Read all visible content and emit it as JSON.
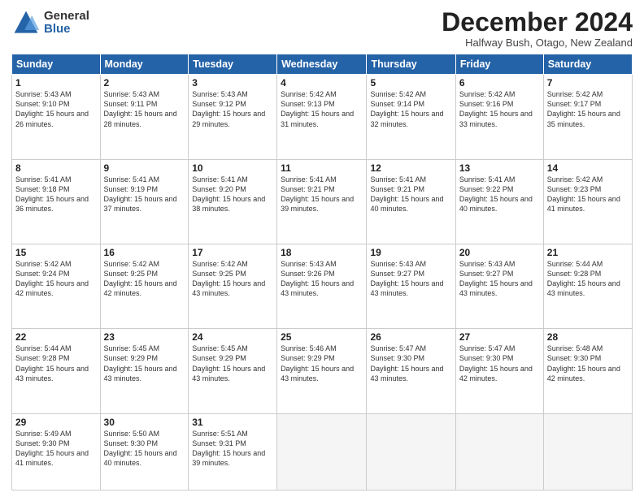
{
  "logo": {
    "general": "General",
    "blue": "Blue"
  },
  "title": "December 2024",
  "location": "Halfway Bush, Otago, New Zealand",
  "weekdays": [
    "Sunday",
    "Monday",
    "Tuesday",
    "Wednesday",
    "Thursday",
    "Friday",
    "Saturday"
  ],
  "weeks": [
    [
      {
        "day": "1",
        "sunrise": "5:43 AM",
        "sunset": "9:10 PM",
        "daylight": "15 hours and 26 minutes."
      },
      {
        "day": "2",
        "sunrise": "5:43 AM",
        "sunset": "9:11 PM",
        "daylight": "15 hours and 28 minutes."
      },
      {
        "day": "3",
        "sunrise": "5:43 AM",
        "sunset": "9:12 PM",
        "daylight": "15 hours and 29 minutes."
      },
      {
        "day": "4",
        "sunrise": "5:42 AM",
        "sunset": "9:13 PM",
        "daylight": "15 hours and 31 minutes."
      },
      {
        "day": "5",
        "sunrise": "5:42 AM",
        "sunset": "9:14 PM",
        "daylight": "15 hours and 32 minutes."
      },
      {
        "day": "6",
        "sunrise": "5:42 AM",
        "sunset": "9:16 PM",
        "daylight": "15 hours and 33 minutes."
      },
      {
        "day": "7",
        "sunrise": "5:42 AM",
        "sunset": "9:17 PM",
        "daylight": "15 hours and 35 minutes."
      }
    ],
    [
      {
        "day": "8",
        "sunrise": "5:41 AM",
        "sunset": "9:18 PM",
        "daylight": "15 hours and 36 minutes."
      },
      {
        "day": "9",
        "sunrise": "5:41 AM",
        "sunset": "9:19 PM",
        "daylight": "15 hours and 37 minutes."
      },
      {
        "day": "10",
        "sunrise": "5:41 AM",
        "sunset": "9:20 PM",
        "daylight": "15 hours and 38 minutes."
      },
      {
        "day": "11",
        "sunrise": "5:41 AM",
        "sunset": "9:21 PM",
        "daylight": "15 hours and 39 minutes."
      },
      {
        "day": "12",
        "sunrise": "5:41 AM",
        "sunset": "9:21 PM",
        "daylight": "15 hours and 40 minutes."
      },
      {
        "day": "13",
        "sunrise": "5:41 AM",
        "sunset": "9:22 PM",
        "daylight": "15 hours and 40 minutes."
      },
      {
        "day": "14",
        "sunrise": "5:42 AM",
        "sunset": "9:23 PM",
        "daylight": "15 hours and 41 minutes."
      }
    ],
    [
      {
        "day": "15",
        "sunrise": "5:42 AM",
        "sunset": "9:24 PM",
        "daylight": "15 hours and 42 minutes."
      },
      {
        "day": "16",
        "sunrise": "5:42 AM",
        "sunset": "9:25 PM",
        "daylight": "15 hours and 42 minutes."
      },
      {
        "day": "17",
        "sunrise": "5:42 AM",
        "sunset": "9:25 PM",
        "daylight": "15 hours and 43 minutes."
      },
      {
        "day": "18",
        "sunrise": "5:43 AM",
        "sunset": "9:26 PM",
        "daylight": "15 hours and 43 minutes."
      },
      {
        "day": "19",
        "sunrise": "5:43 AM",
        "sunset": "9:27 PM",
        "daylight": "15 hours and 43 minutes."
      },
      {
        "day": "20",
        "sunrise": "5:43 AM",
        "sunset": "9:27 PM",
        "daylight": "15 hours and 43 minutes."
      },
      {
        "day": "21",
        "sunrise": "5:44 AM",
        "sunset": "9:28 PM",
        "daylight": "15 hours and 43 minutes."
      }
    ],
    [
      {
        "day": "22",
        "sunrise": "5:44 AM",
        "sunset": "9:28 PM",
        "daylight": "15 hours and 43 minutes."
      },
      {
        "day": "23",
        "sunrise": "5:45 AM",
        "sunset": "9:29 PM",
        "daylight": "15 hours and 43 minutes."
      },
      {
        "day": "24",
        "sunrise": "5:45 AM",
        "sunset": "9:29 PM",
        "daylight": "15 hours and 43 minutes."
      },
      {
        "day": "25",
        "sunrise": "5:46 AM",
        "sunset": "9:29 PM",
        "daylight": "15 hours and 43 minutes."
      },
      {
        "day": "26",
        "sunrise": "5:47 AM",
        "sunset": "9:30 PM",
        "daylight": "15 hours and 43 minutes."
      },
      {
        "day": "27",
        "sunrise": "5:47 AM",
        "sunset": "9:30 PM",
        "daylight": "15 hours and 42 minutes."
      },
      {
        "day": "28",
        "sunrise": "5:48 AM",
        "sunset": "9:30 PM",
        "daylight": "15 hours and 42 minutes."
      }
    ],
    [
      {
        "day": "29",
        "sunrise": "5:49 AM",
        "sunset": "9:30 PM",
        "daylight": "15 hours and 41 minutes."
      },
      {
        "day": "30",
        "sunrise": "5:50 AM",
        "sunset": "9:30 PM",
        "daylight": "15 hours and 40 minutes."
      },
      {
        "day": "31",
        "sunrise": "5:51 AM",
        "sunset": "9:31 PM",
        "daylight": "15 hours and 39 minutes."
      },
      null,
      null,
      null,
      null
    ]
  ]
}
